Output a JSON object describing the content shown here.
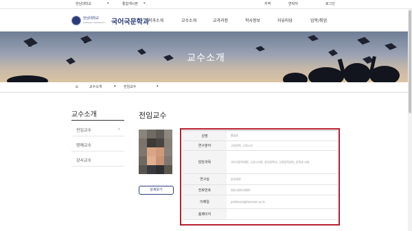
{
  "top_bar": {
    "left_items": [
      "한남대학교",
      "통합게시판"
    ],
    "right_items": [
      "지역",
      "연락처",
      "로그인"
    ]
  },
  "logo": {
    "school_name": "한남대학교",
    "school_en": "HANNAM UNIVERSITY",
    "department": "국어국문학과"
  },
  "nav": [
    "학과소개",
    "교수소개",
    "교과과정",
    "학사정보",
    "자유마당",
    "입학/취업"
  ],
  "hero": {
    "title": "교수소개"
  },
  "breadcrumb": {
    "items": [
      "교수소개",
      "전임교수"
    ]
  },
  "sidebar": {
    "title": "교수소개",
    "items": [
      {
        "label": "전임교수",
        "active": true
      },
      {
        "label": "명예교수",
        "active": false
      },
      {
        "label": "강사교수",
        "active": false
      }
    ]
  },
  "main": {
    "title": "전임교수",
    "detail_button": "상세보기"
  },
  "profile": {
    "rows": [
      {
        "label": "성명",
        "value": "홍길동"
      },
      {
        "label": "연구분야",
        "value": "고전문학, 고전시가"
      },
      {
        "label": "담당과목",
        "value": "국어국문학개론, 고전시가론, 한국문학사, 고전문학강독, 문학과 사회"
      },
      {
        "label": "연구실",
        "value": "문과대학"
      },
      {
        "label": "전화번호",
        "value": "042-629-0000"
      },
      {
        "label": "이메일",
        "value": "professor@hannam.ac.kr"
      },
      {
        "label": "홈페이지",
        "value": ""
      }
    ]
  },
  "colors": {
    "brand": "#2b3b7a",
    "highlight_box": "#b71c2c"
  }
}
